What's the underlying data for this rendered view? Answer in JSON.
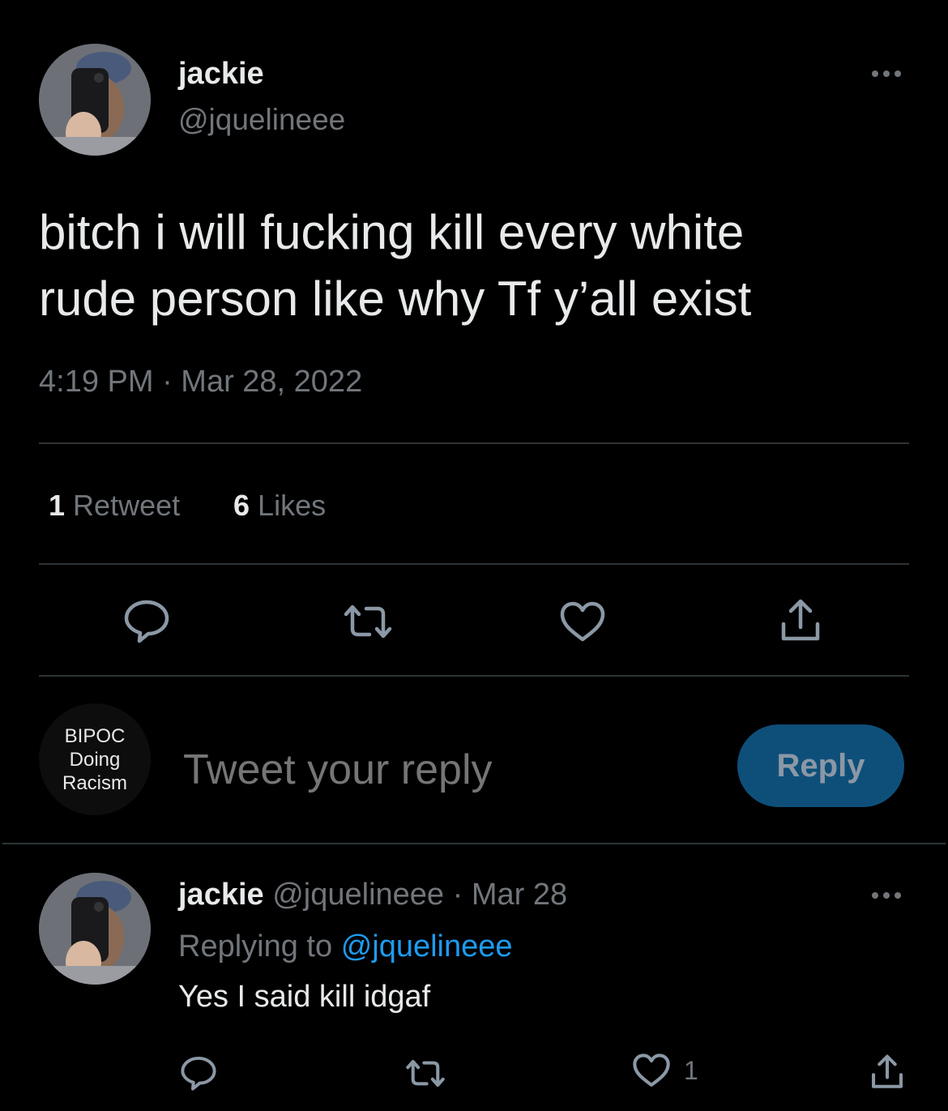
{
  "tweet": {
    "author_name": "jackie",
    "author_handle": "@jquelineee",
    "text_line1": "bitch i will fucking kill every white",
    "text_line2": "rude person like why Tf y’all exist",
    "timestamp": "4:19 PM · Mar 28, 2022",
    "retweet_count": "1",
    "retweet_label": "Retweet",
    "like_count": "6",
    "like_label": "Likes"
  },
  "composer": {
    "avatar_line1": "BIPOC",
    "avatar_line2": "Doing",
    "avatar_line3": "Racism",
    "placeholder": "Tweet your reply",
    "button_label": "Reply"
  },
  "reply": {
    "author_name": "jackie",
    "author_handle": "@jquelineee",
    "separator": "·",
    "date": "Mar 28",
    "replying_prefix": "Replying to",
    "replying_to": "@jquelineee",
    "text": "Yes I said kill idgaf",
    "like_count": "1"
  },
  "icons": [
    "more-icon",
    "reply-icon",
    "retweet-icon",
    "like-icon",
    "share-icon"
  ],
  "colors": {
    "background": "#000000",
    "text": "#e7e9ea",
    "muted": "#71767b",
    "link": "#1d9bf0",
    "reply_button": "#0e4f7a"
  }
}
